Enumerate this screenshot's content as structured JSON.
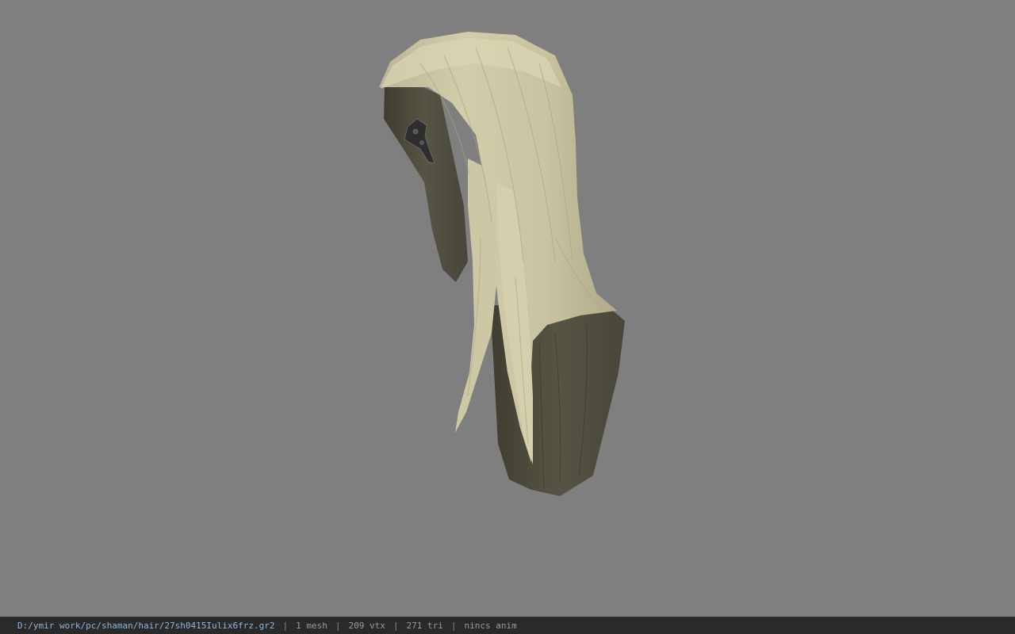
{
  "viewer": {
    "background_color": "#7f7f7f",
    "model": {
      "hair_color": "#cfcaa6",
      "scalp_color": "#4f4d3d",
      "icon": "hair-mesh"
    }
  },
  "status_bar": {
    "file_path": "D:/ymir work/pc/shaman/hair/27sh0415Iulix6frz.gr2",
    "separator": "|",
    "mesh_count": "1 mesh",
    "vertex_count": "209 vtx",
    "triangle_count": "271 tri",
    "anim_status": "nincs anim"
  }
}
